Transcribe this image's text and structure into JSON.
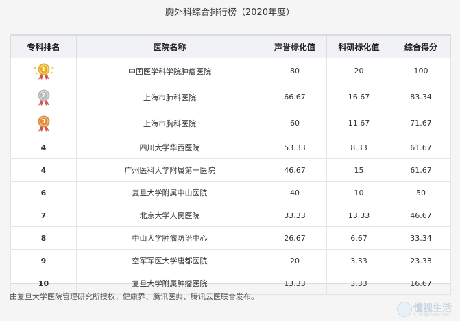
{
  "title": "胸外科综合排行榜（2020年度）",
  "columns": [
    "专科排名",
    "医院名称",
    "声誉标化值",
    "科研标化值",
    "综合得分"
  ],
  "rows": [
    {
      "rank": "1",
      "hospital": "中国医学科学院肿瘤医院",
      "reputation": "80",
      "research": "20",
      "total": "100",
      "medal": "gold"
    },
    {
      "rank": "2",
      "hospital": "上海市肺科医院",
      "reputation": "66.67",
      "research": "16.67",
      "total": "83.34",
      "medal": "silver"
    },
    {
      "rank": "3",
      "hospital": "上海市胸科医院",
      "reputation": "60",
      "research": "11.67",
      "total": "71.67",
      "medal": "bronze"
    },
    {
      "rank": "4",
      "hospital": "四川大学华西医院",
      "reputation": "53.33",
      "research": "8.33",
      "total": "61.67",
      "medal": ""
    },
    {
      "rank": "4",
      "hospital": "广州医科大学附属第一医院",
      "reputation": "46.67",
      "research": "15",
      "total": "61.67",
      "medal": ""
    },
    {
      "rank": "6",
      "hospital": "复旦大学附属中山医院",
      "reputation": "40",
      "research": "10",
      "total": "50",
      "medal": ""
    },
    {
      "rank": "7",
      "hospital": "北京大学人民医院",
      "reputation": "33.33",
      "research": "13.33",
      "total": "46.67",
      "medal": ""
    },
    {
      "rank": "8",
      "hospital": "中山大学肿瘤防治中心",
      "reputation": "26.67",
      "research": "6.67",
      "total": "33.34",
      "medal": ""
    },
    {
      "rank": "9",
      "hospital": "空军军医大学唐都医院",
      "reputation": "20",
      "research": "3.33",
      "total": "23.33",
      "medal": ""
    },
    {
      "rank": "10",
      "hospital": "复旦大学附属肿瘤医院",
      "reputation": "13.33",
      "research": "3.33",
      "total": "16.67",
      "medal": ""
    }
  ],
  "footer": "由复旦大学医院管理研究所授权，健康界、腾讯医典、腾讯云医联合发布。",
  "watermark": {
    "text": "懂视生活",
    "sub": "STDONGSHI.COM"
  },
  "colors": {
    "gold": "#e8b024",
    "silver": "#b8b8b8",
    "bronze": "#e08a3c",
    "ribbon": "#d9534f"
  }
}
